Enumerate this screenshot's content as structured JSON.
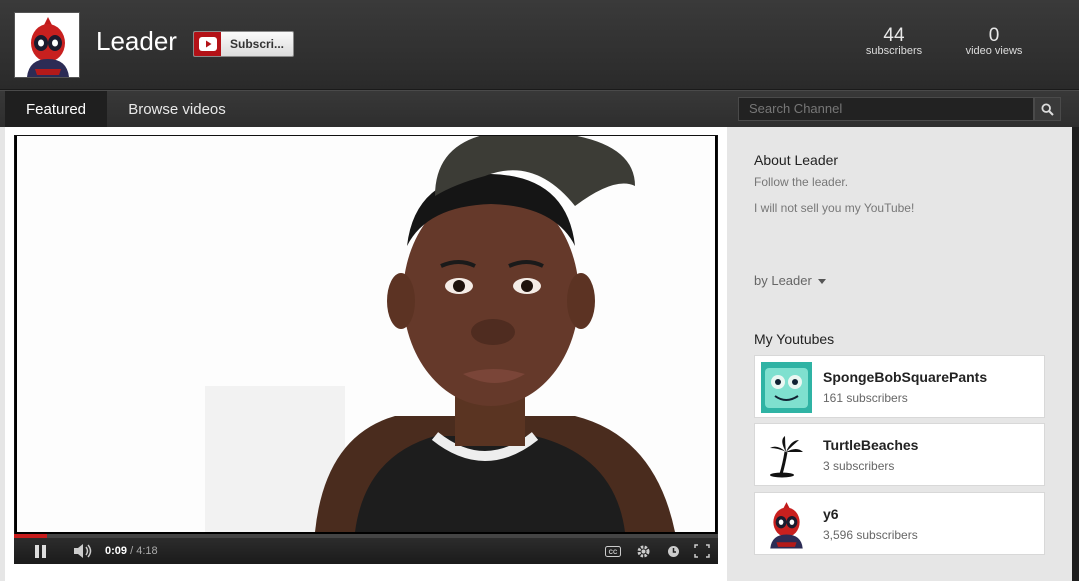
{
  "channel": {
    "name": "Leader",
    "subscribe_label": "Subscri...",
    "stats": [
      {
        "num": "44",
        "cap": "subscribers"
      },
      {
        "num": "0",
        "cap": "video views"
      }
    ]
  },
  "nav": {
    "tabs": [
      {
        "label": "Featured"
      },
      {
        "label": "Browse videos"
      }
    ],
    "search_placeholder": "Search Channel"
  },
  "player": {
    "current_time": "0:09",
    "separator": " / ",
    "duration": "4:18",
    "progress_fraction": 0.047
  },
  "about": {
    "title": "About Leader",
    "lines": [
      "Follow the leader.",
      "I will not sell you my YouTube!"
    ],
    "byline": "by Leader"
  },
  "my_youtubes": {
    "title": "My Youtubes",
    "items": [
      {
        "name": "SpongeBobSquarePants",
        "subs": "161 subscribers"
      },
      {
        "name": "TurtleBeaches",
        "subs": "3 subscribers"
      },
      {
        "name": "y6",
        "subs": "3,596 subscribers"
      }
    ]
  },
  "colors": {
    "accent_red": "#b31217",
    "progress_red": "#c81c1c"
  }
}
